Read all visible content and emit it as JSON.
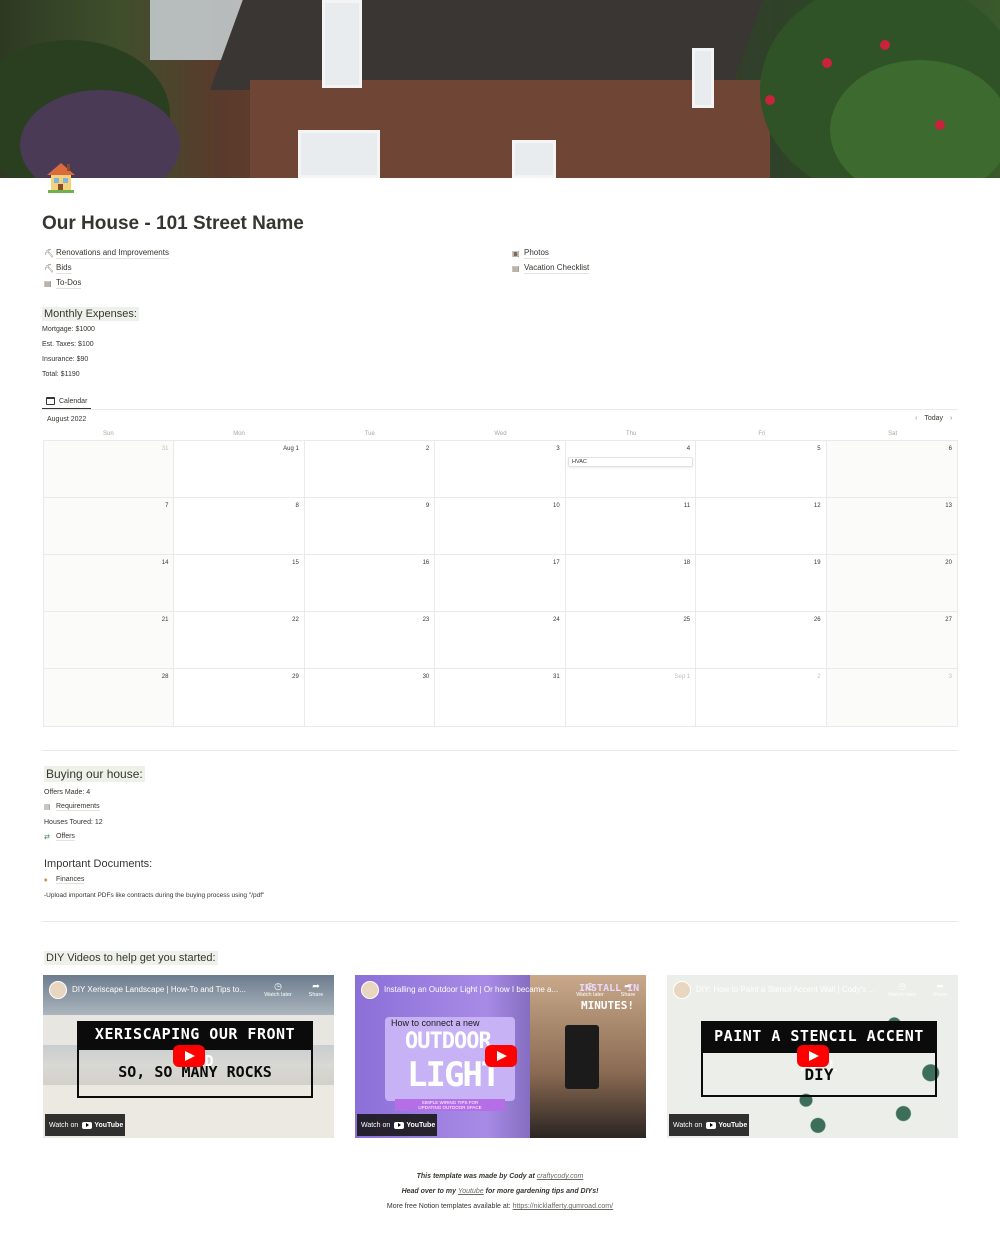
{
  "page": {
    "icon": "house-emoji",
    "title": "Our House - 101 Street Name"
  },
  "links_left": [
    {
      "icon": "hammer-icon",
      "glyph": "⛏",
      "label": "Renovations and Improvements"
    },
    {
      "icon": "hammer-icon",
      "glyph": "⛏",
      "label": "Bids"
    },
    {
      "icon": "page-icon",
      "glyph": "▤",
      "label": "To-Dos"
    }
  ],
  "links_right": [
    {
      "icon": "camera-icon",
      "glyph": "▣",
      "label": "Photos"
    },
    {
      "icon": "page-icon",
      "glyph": "▤",
      "label": "Vacation Checklist"
    }
  ],
  "expenses": {
    "heading": "Monthly Expenses:",
    "items": [
      "Mortgage: $1000",
      "Est. Taxes: $100",
      "Insurance: $90",
      "Total: $1190"
    ]
  },
  "calendar": {
    "tab_label": "Calendar",
    "month": "August 2022",
    "today": "Today",
    "prev": "‹",
    "next": "›",
    "weekdays": [
      "Sun",
      "Mon",
      "Tue",
      "Wed",
      "Thu",
      "Fri",
      "Sat"
    ],
    "weeks": [
      [
        "31",
        "Aug 1",
        "2",
        "3",
        "4",
        "5",
        "6"
      ],
      [
        "7",
        "8",
        "9",
        "10",
        "11",
        "12",
        "13"
      ],
      [
        "14",
        "15",
        "16",
        "17",
        "18",
        "19",
        "20"
      ],
      [
        "21",
        "22",
        "23",
        "24",
        "25",
        "26",
        "27"
      ],
      [
        "28",
        "29",
        "30",
        "31",
        "Sep 1",
        "2",
        "3"
      ]
    ],
    "event": "HVAC"
  },
  "buying": {
    "heading": "Buying our house:",
    "offers": "Offers Made: 4",
    "requirements": "Requirements",
    "toured": "Houses Toured: 12",
    "offers_link": "Offers"
  },
  "documents": {
    "heading": "Important Documents:",
    "finances": "Finances",
    "note": "-Upload important PDFs like contracts during the buying process using \"/pdf\""
  },
  "diy": {
    "heading": "DIY Videos to help get you started:",
    "watch_later": "Watch later",
    "share": "Share",
    "watch_on": "Watch on",
    "youtube": "YouTube",
    "videos": [
      {
        "title": "DIY Xeriscape Landscape | How-To and Tips to...",
        "line1": "XERISCAPING OUR FRONT YARD",
        "line2": "SO, SO MANY ROCKS"
      },
      {
        "title": "Installing an Outdoor Light | Or how I became a...",
        "line0": "INSTALL IN",
        "line0b": "MINUTES!",
        "line1": "How to connect a new",
        "line2": "OUTDOOR",
        "line3": "LIGHT",
        "line4": "SIMPLE WIRING TIPS FOR",
        "line5": "UPDATING OUTDOOR SPACE"
      },
      {
        "title": "DIY: How to Paint a Stencil Accent Wall | Cody's ...",
        "line1": "PAINT A STENCIL ACCENT WALL",
        "line2": "DIY"
      }
    ]
  },
  "footer": {
    "line1_a": "This template was made by Cody at",
    "line1_link": "craftycody.com",
    "line2_a": "Head over to my",
    "line2_link": "Youtube",
    "line2_b": "for more gardening tips and DIYs!",
    "line3_a": "More free Notion templates available at:",
    "line3_link": "https://nicklafferty.gumroad.com/"
  },
  "colors": {
    "text": "#37352f",
    "accent_highlight": "#eef1ea",
    "youtube_red": "#ff0000"
  }
}
